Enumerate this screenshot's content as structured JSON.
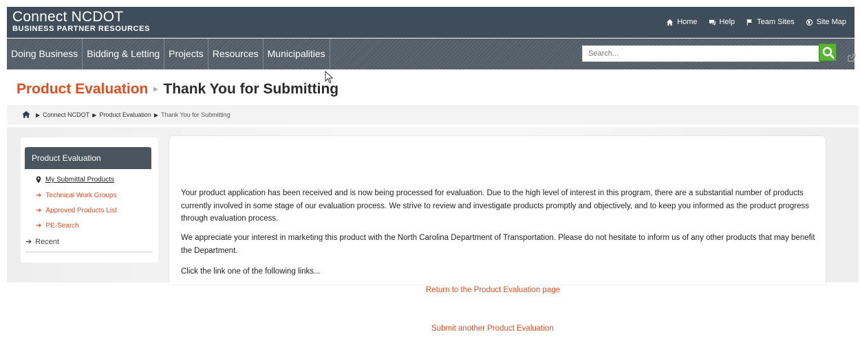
{
  "header": {
    "title": "Connect NCDOT",
    "subtitle": "BUSINESS PARTNER RESOURCES",
    "links": [
      {
        "label": "Home",
        "icon": "home-icon"
      },
      {
        "label": "Help",
        "icon": "chat-icon"
      },
      {
        "label": "Team Sites",
        "icon": "flag-icon"
      },
      {
        "label": "Site Map",
        "icon": "globe-icon"
      }
    ]
  },
  "nav": {
    "items": [
      "Doing Business",
      "Bidding & Letting",
      "Projects",
      "Resources",
      "Municipalities"
    ],
    "search_placeholder": "Search..."
  },
  "page": {
    "title_section": "Product Evaluation",
    "title_page": "Thank You for Submitting"
  },
  "breadcrumb": {
    "items": [
      "Connect NCDOT",
      "Product Evaluation",
      "Thank You for Submitting"
    ]
  },
  "sidebar": {
    "header": "Product Evaluation",
    "items": [
      "My Submittal Products",
      "Technical Work Groups",
      "Approved Products List",
      "PE-Search"
    ],
    "recent": "Recent"
  },
  "main": {
    "para1": "Your product application has been received and is now being processed for evaluation.  Due to the high level of interest in this program, there are a substantial number of products currently involved in some stage of our evaluation process.  We strive to review and investigate products promptly and objectively, and to keep you informed as the product progress through evaluation process.",
    "para2": "We appreciate your interest in marketing this product with the North Carolina Department of Transportation.  Please do not hesitate to inform us of any other products that may benefit the Department.",
    "para3": "Click the link one of the following links...",
    "link1": "Return to the Product Evaluation page",
    "link2": "Submit another Product Evaluation"
  },
  "colors": {
    "accent": "#e04e1f",
    "header_bg": "#3f4d5a",
    "nav_bg": "#545e68",
    "search_button": "#5bb336"
  }
}
